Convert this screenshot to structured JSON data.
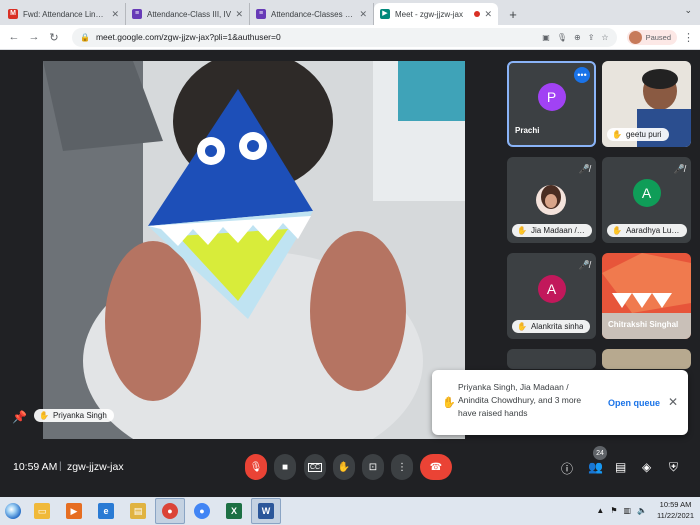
{
  "browser": {
    "tabs": [
      {
        "label": "Fwd: Attendance Link for III - IV",
        "icon": "gmail-icon",
        "color": "#d93025",
        "glyph": "M"
      },
      {
        "label": "Attendance-Class III, IV",
        "icon": "forms-icon",
        "color": "#673ab7",
        "glyph": "≡"
      },
      {
        "label": "Attendance-Classes V TO VIII",
        "icon": "forms-icon",
        "color": "#673ab7",
        "glyph": "≡"
      },
      {
        "label": "Meet - zgw-jjzw-jax",
        "icon": "meet-icon",
        "color": "#00897b",
        "glyph": "▶"
      }
    ],
    "url": "meet.google.com/zgw-jjzw-jax?pli=1&authuser=0",
    "profile_status": "Paused"
  },
  "meet": {
    "presenter_name": "Priyanka Singh",
    "tiles": [
      {
        "name": "Prachi",
        "initial": "P",
        "color": "#a142f4",
        "type": "avatar"
      },
      {
        "name": "geetu puri",
        "type": "video"
      },
      {
        "name": "Jia Madaan / ...",
        "type": "photo"
      },
      {
        "name": "Aaradhya Lut...",
        "initial": "A",
        "color": "#0f9d58",
        "type": "avatar"
      },
      {
        "name": "Alankrita sinha",
        "initial": "A",
        "color": "#c2185b",
        "type": "avatar"
      },
      {
        "name": "Chitrakshi Singhal",
        "type": "video"
      }
    ],
    "toast": {
      "message": "Priyanka Singh, Jia Madaan / Anindita Chowdhury, and 3 more have raised hands",
      "action": "Open queue"
    },
    "bottom": {
      "time": "10:59 AM",
      "separator": "|",
      "meeting_code": "zgw-jjzw-jax",
      "participant_count": "24"
    }
  },
  "taskbar": {
    "apps": [
      {
        "name": "explorer",
        "color": "#f0b93a",
        "glyph": "▭"
      },
      {
        "name": "media-player",
        "color": "#e66e22",
        "glyph": "▶"
      },
      {
        "name": "internet-explorer",
        "color": "#2a7bd4",
        "glyph": "e"
      },
      {
        "name": "file-folder",
        "color": "#e0b341",
        "glyph": "▤"
      },
      {
        "name": "chrome",
        "color": "#db4437",
        "glyph": "●"
      },
      {
        "name": "chrome-alt",
        "color": "#4285f4",
        "glyph": "●"
      },
      {
        "name": "excel",
        "color": "#1d7044",
        "glyph": "X"
      },
      {
        "name": "word",
        "color": "#2b579a",
        "glyph": "W"
      }
    ],
    "clock_time": "10:59 AM",
    "clock_date": "11/22/2021"
  }
}
